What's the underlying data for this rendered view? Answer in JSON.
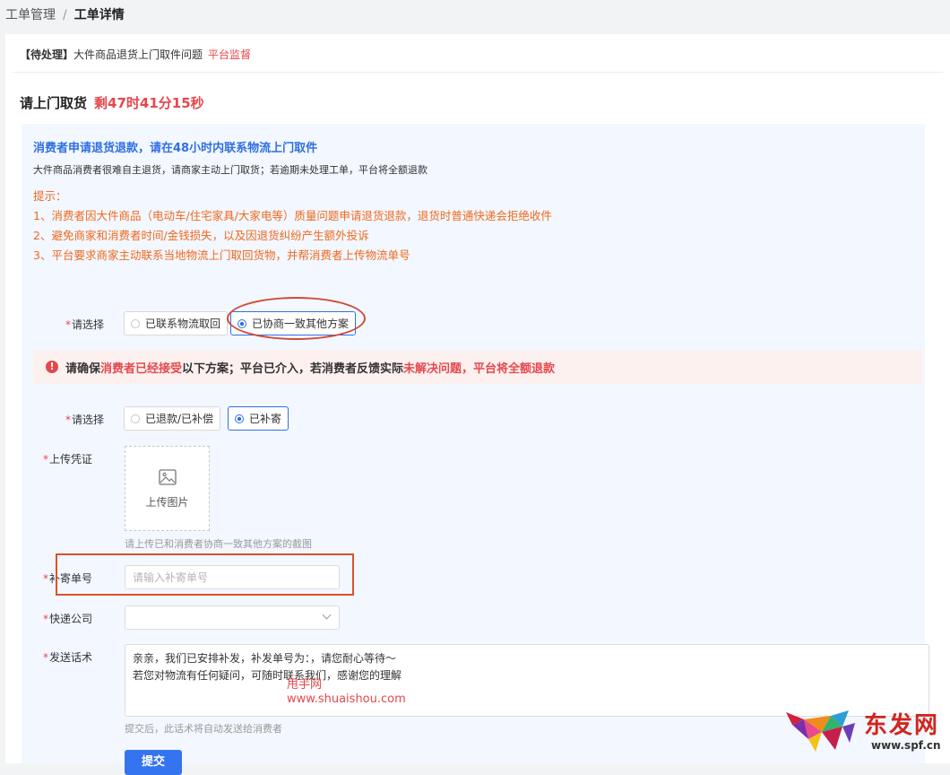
{
  "breadcrumb": {
    "parent": "工单管理",
    "separator": "/",
    "current": "工单详情"
  },
  "ticket": {
    "status": "【待处理】",
    "title": "大件商品退货上门取件问题",
    "tag": "平台监督"
  },
  "section": {
    "title": "请上门取货",
    "countdown": "剩47时41分15秒"
  },
  "notice": {
    "title": "消费者申请退货退款，请在48小时内联系物流上门取件",
    "subtitle": "大件商品消费者很难自主退货，请商家主动上门取货；若逾期未处理工单，平台将全额退款",
    "tips_heading": "提示：",
    "tips": [
      "1、消费者因大件商品（电动车/住宅家具/大家电等）质量问题申请退货退款，退货时普通快递会拒绝收件",
      "2、避免商家和消费者时间/金钱损失，以及因退货纠纷产生额外投诉",
      "3、平台要求商家主动联系当地物流上门取回货物，并帮消费者上传物流单号"
    ]
  },
  "select1": {
    "label": "请选择",
    "options": [
      "已联系物流取回",
      "已协商一致其他方案"
    ],
    "selected": 1
  },
  "warning": {
    "p1": "请确保",
    "r1": "消费者已经接受",
    "p2": "以下方案；平台已介入，若消费者反馈实际",
    "r2": "未解决问题，平台将全额退款"
  },
  "select2": {
    "label": "请选择",
    "options": [
      "已退款/已补偿",
      "已补寄"
    ],
    "selected": 1
  },
  "upload": {
    "label": "上传凭证",
    "button": "上传图片",
    "hint": "请上传已和消费者协商一致其他方案的截图"
  },
  "tracking": {
    "label": "补寄单号",
    "placeholder": "请输入补寄单号",
    "value": ""
  },
  "courier": {
    "label": "快递公司",
    "value": ""
  },
  "message": {
    "label": "发送话术",
    "text": "亲亲，我们已安排补发，补发单号为：，请您耐心等待～\n若您对物流有任何疑问，可随时联系我们，感谢您的理解",
    "hint": "提交后，此话术将自动发送给消费者"
  },
  "submit_label": "提交",
  "watermark": {
    "line1": "甩手网",
    "line2": "www.shuaishou.com"
  },
  "logo": {
    "text": "东发网",
    "url": "www.spf.cn"
  },
  "colors": {
    "accent": "#3574f0",
    "danger": "#e5484d",
    "tip": "#ee6a1f"
  }
}
